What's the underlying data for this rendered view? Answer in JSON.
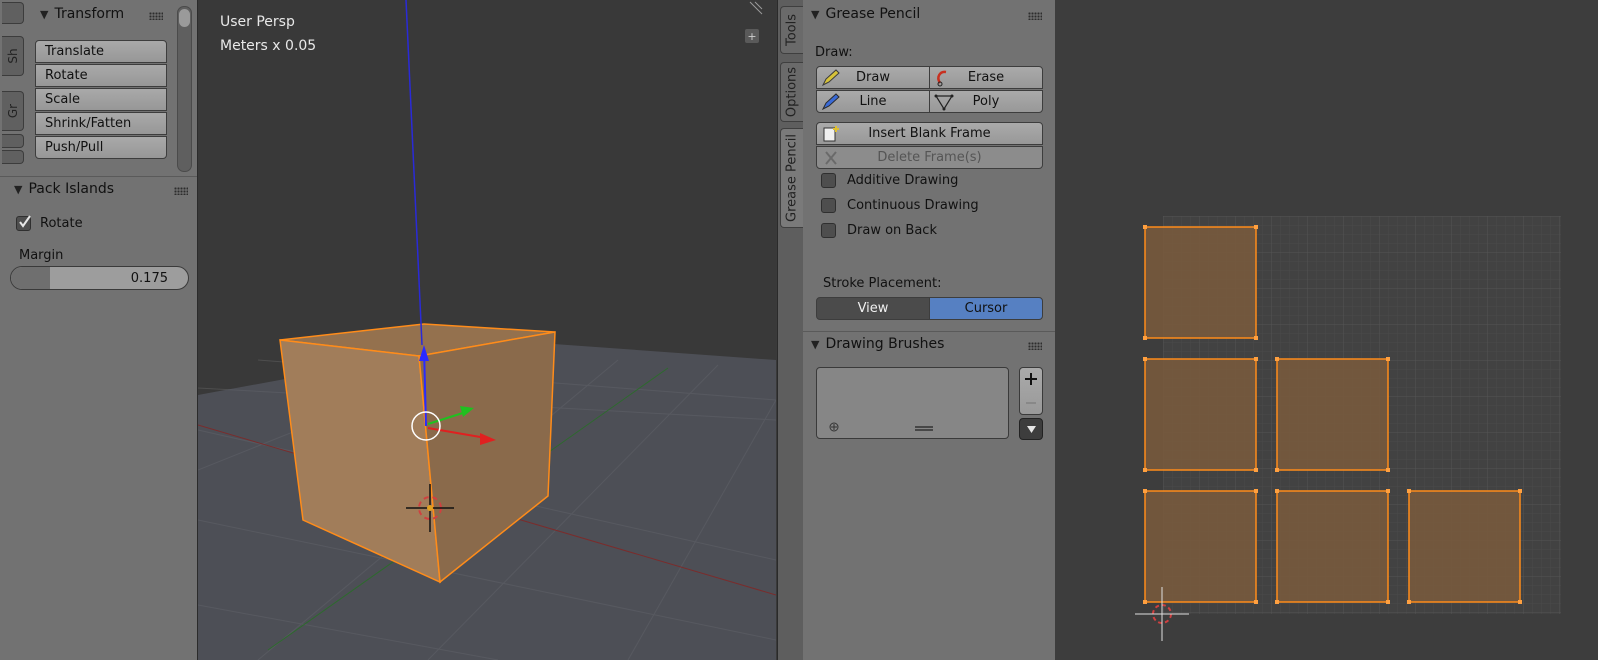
{
  "left_shelf": {
    "tabs": [
      "Sh",
      "Gr"
    ],
    "transform": {
      "title": "Transform",
      "buttons": [
        "Translate",
        "Rotate",
        "Scale",
        "Shrink/Fatten",
        "Push/Pull"
      ]
    },
    "pack_islands": {
      "title": "Pack Islands",
      "rotate_label": "Rotate",
      "rotate_checked": true,
      "margin_label": "Margin",
      "margin_value": "0.175",
      "margin_fraction": 0.175
    }
  },
  "viewport": {
    "view_name": "User Persp",
    "units": "Meters x 0.05"
  },
  "properties": {
    "tabs": [
      "Tools",
      "Options",
      "Grease Pencil"
    ],
    "active_tab": "Grease Pencil",
    "grease_pencil": {
      "title": "Grease Pencil",
      "draw_label": "Draw:",
      "draw_button": "Draw",
      "erase_button": "Erase",
      "line_button": "Line",
      "poly_button": "Poly",
      "insert_blank_frame": "Insert Blank Frame",
      "delete_frames": "Delete Frame(s)",
      "options": [
        "Additive Drawing",
        "Continuous Drawing",
        "Draw on Back"
      ],
      "stroke_placement_label": "Stroke Placement:",
      "placement_view": "View",
      "placement_cursor": "Cursor",
      "placement_active": "Cursor"
    },
    "drawing_brushes": {
      "title": "Drawing Brushes"
    }
  },
  "colors": {
    "accent_blue": "#5680c2",
    "selection_orange": "#ff8c1a",
    "face_brown": "#7a5a3c"
  }
}
